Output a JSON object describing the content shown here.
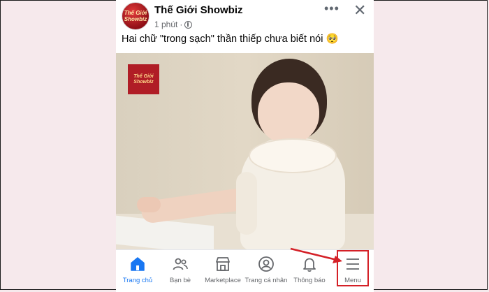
{
  "post": {
    "page_name": "Thế Giới Showbiz",
    "avatar_text": "Thế Giới Showbiz",
    "time": "1 phút",
    "separator": "·",
    "caption": "Hai chữ \"trong sạch\" thần thiếp chưa biết nói 🥺",
    "more_symbol": "•••",
    "close_symbol": "✕",
    "watermark_text": "Thế Giới Showbiz"
  },
  "tabbar": {
    "items": [
      {
        "label": "Trang chủ",
        "icon": "home-icon",
        "active": true
      },
      {
        "label": "Bạn bè",
        "icon": "friends-icon",
        "active": false
      },
      {
        "label": "Marketplace",
        "icon": "marketplace-icon",
        "active": false
      },
      {
        "label": "Trang cá nhân",
        "icon": "profile-icon",
        "active": false
      },
      {
        "label": "Thông báo",
        "icon": "bell-icon",
        "active": false
      },
      {
        "label": "Menu",
        "icon": "menu-icon",
        "active": false
      }
    ]
  },
  "colors": {
    "accent": "#1877f2",
    "highlight": "#d42027",
    "background": "#f6e9ec"
  }
}
